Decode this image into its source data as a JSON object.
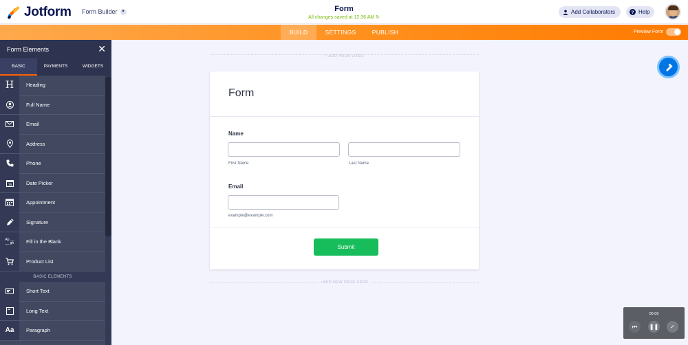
{
  "brand": {
    "name": "Jotform"
  },
  "header": {
    "builder_label": "Form Builder",
    "form_title": "Form",
    "save_status": "All changes saved at 12:36 AM",
    "collab_label": "Add Collaborators",
    "help_label": "Help"
  },
  "nav": {
    "tabs": [
      {
        "label": "BUILD",
        "active": true
      },
      {
        "label": "SETTINGS",
        "active": false
      },
      {
        "label": "PUBLISH",
        "active": false
      }
    ],
    "preview_label": "Preview Form"
  },
  "sidebar": {
    "title": "Form Elements",
    "tabs": [
      {
        "label": "BASIC",
        "active": true
      },
      {
        "label": "PAYMENTS",
        "active": false
      },
      {
        "label": "WIDGETS",
        "active": false
      }
    ],
    "items": [
      {
        "label": "Heading",
        "icon": "heading-icon"
      },
      {
        "label": "Full Name",
        "icon": "user-icon"
      },
      {
        "label": "Email",
        "icon": "envelope-icon"
      },
      {
        "label": "Address",
        "icon": "location-pin-icon"
      },
      {
        "label": "Phone",
        "icon": "phone-icon"
      },
      {
        "label": "Date Picker",
        "icon": "calendar-icon"
      },
      {
        "label": "Appointment",
        "icon": "appointment-icon"
      },
      {
        "label": "Signature",
        "icon": "pen-icon"
      },
      {
        "label": "Fill in the Blank",
        "icon": "fill-blank-icon"
      },
      {
        "label": "Product List",
        "icon": "cart-icon"
      }
    ],
    "section_label": "BASIC ELEMENTS",
    "basic_items": [
      {
        "label": "Short Text",
        "icon": "short-text-icon"
      },
      {
        "label": "Long Text",
        "icon": "long-text-icon"
      },
      {
        "label": "Paragraph",
        "icon": "paragraph-icon"
      }
    ]
  },
  "canvas": {
    "add_logo": "+ ADD YOUR LOGO",
    "add_page": "+ADD NEW PAGE HERE"
  },
  "form": {
    "heading": "Form",
    "name_label": "Name",
    "first_name_sub": "First Name",
    "last_name_sub": "Last Name",
    "email_label": "Email",
    "email_sub": "example@example.com",
    "submit_label": "Submit"
  },
  "recorder": {
    "time": "00:00"
  },
  "colors": {
    "accent": "#ff6100",
    "submit": "#18bd5b",
    "sidebar": "#414860",
    "paint": "#0075e3"
  }
}
